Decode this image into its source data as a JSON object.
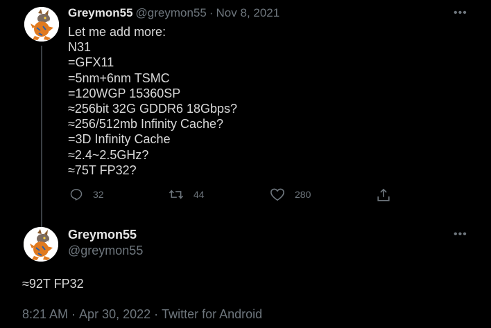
{
  "tweet1": {
    "display_name": "Greymon55",
    "handle": "@greymon55",
    "separator": "·",
    "date": "Nov 8, 2021",
    "more_icon": "more-icon",
    "text": "Let me add more:\nN31\n=GFX11\n=5nm+6nm TSMC\n=120WGP 15360SP\n≈256bit 32G GDDR6 18Gbps?\n≈256/512mb Infinity Cache?\n=3D Infinity Cache\n≈2.4~2.5GHz?\n≈75T FP32?",
    "actions": {
      "reply_count": "32",
      "retweet_count": "44",
      "like_count": "280"
    }
  },
  "tweet2": {
    "display_name": "Greymon55",
    "handle": "@greymon55",
    "more_icon": "more-icon",
    "text": "≈92T FP32",
    "time": "8:21 AM",
    "separator": "·",
    "date": "Apr 30, 2022",
    "source": "Twitter for Android"
  },
  "colors": {
    "background": "#000000",
    "text": "#d9d9d9",
    "muted": "#6e767d",
    "thread_line": "#3a3f44"
  }
}
